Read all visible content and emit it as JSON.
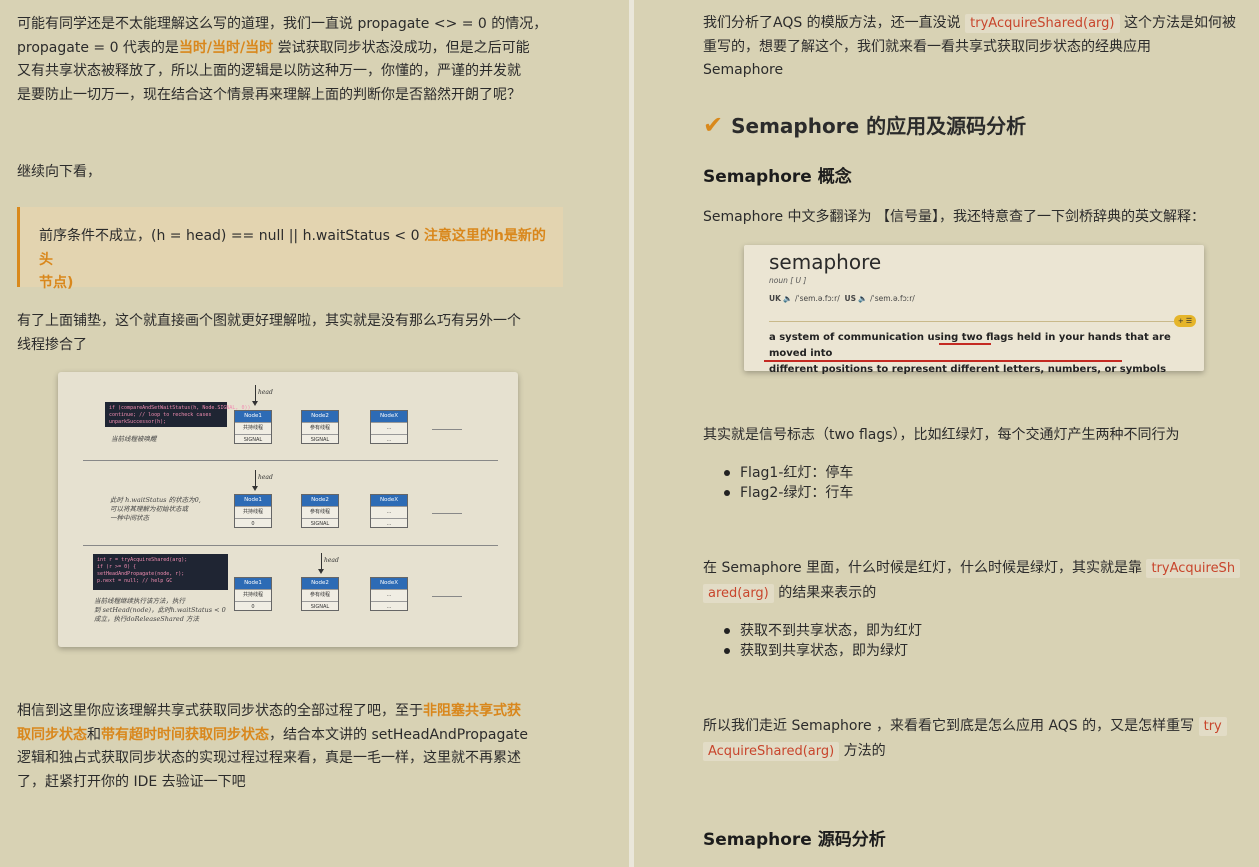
{
  "left": {
    "p1": [
      "可能有同学还是不太能理解这么写的道理，我们一直说 propagate <> = 0 的情况，",
      "propagate = 0 代表的是",
      "当时/当时/当时",
      " 尝试获取同步状态没成功，但是之后可能",
      "又有共享状态被释放了，所以上面的逻辑是以防这种万一，你懂的，严谨的并发就",
      "是要防止一切万一，现在结合这个情景再来理解上面的判断你是否豁然开朗了呢？"
    ],
    "p2": "继续向下看，",
    "quote": [
      "前序条件不成立，(h = head) == null || h.waitStatus < 0 ",
      "注意这里的h是新的头",
      "节点)"
    ],
    "p3": [
      "有了上面铺垫，这个就直接画个图就更好理解啦，其实就是没有那么巧有另外一个",
      "线程掺合了"
    ],
    "figure": {
      "head": "head",
      "node1": "Node1",
      "node2": "Node2",
      "node3": "NodeX",
      "row1_note": "当前线程被唤醒",
      "row2_note": [
        "此时 h.waitStatus 的状态为0,",
        "可以将其理解为初始状态或",
        "一种中间状态"
      ],
      "row3_note": [
        "当前线程继续执行该方法，执行",
        "到 setHead(node)，此时h.waitStatus < 0",
        "成立，执行doReleaseShared 方法"
      ],
      "cell_thread": "共持线程",
      "cell_thread2": "参有线程",
      "cell_signal": "SIGNAL",
      "cell_zero": "0",
      "cell_dots": "…",
      "code1": [
        "if (compareAndSetWaitStatus(h, Node.SIGNAL, 0))",
        "    continue;      // loop to recheck cases",
        "unparkSuccessor(h);"
      ],
      "code3": [
        "int r = tryAcquireShared(arg);",
        "if (r >= 0) {",
        "    setHeadAndPropagate(node, r);",
        "    p.next = null; // help GC"
      ]
    },
    "p4": [
      "相信到这里你应该理解共享式获取同步状态的全部过程了吧，至于",
      "非阻塞共享式获",
      "取同步状态",
      "和",
      "带有超时时间获取同步状态",
      "，结合本文讲的 setHeadAndPropagate",
      "逻辑和独占式获取同步状态的实现过程过程来看，真是一毛一样，这里就不再累述",
      "了，赶紧打开你的 IDE 去验证一下吧"
    ]
  },
  "right": {
    "p1": [
      "我们分析了AQS 的模版方法，还一直没说 ",
      "tryAcquireShared(arg)",
      " 这个方法是如何被",
      "重写的，想要了解这个，我们就来看一看共享式获取同步状态的经典应用",
      "Semaphore"
    ],
    "section_title": "Semaphore 的应用及源码分析",
    "sub1": "Semaphore 概念",
    "p2": "Semaphore 中文多翻译为 【信号量】，我还特意查了一下剑桥辞典的英文解释：",
    "dict": {
      "word": "semaphore",
      "pos": "noun [ U ]",
      "uk": "UK",
      "uk_pron": "/ˈsem.ə.fɔːr/",
      "us": "US",
      "us_pron": "/ˈsem.ə.fɔːr/",
      "badge": "+ ☰",
      "def1a": "a system of communication using ",
      "def1b": "two flags",
      "def1c": " held in your hands that are moved into",
      "def2": "different positions to represent different letters, numbers, or symbols"
    },
    "p3": "其实就是信号标志（two flags），比如红绿灯，每个交通灯产生两种不同行为",
    "list1": [
      "Flag1-红灯：停车",
      "Flag2-绿灯：行车"
    ],
    "p4": [
      "在 Semaphore 里面，什么时候是红灯，什么时候是绿灯，其实就是靠 ",
      "tryAcquireSh",
      "ared(arg)",
      " 的结果来表示的"
    ],
    "list2": [
      "获取不到共享状态，即为红灯",
      "获取到共享状态，即为绿灯"
    ],
    "p5": [
      "所以我们走近 Semaphore ，来看看它到底是怎么应用 AQS 的，又是怎样重写 ",
      "try",
      "AcquireShared(arg)",
      " 方法的"
    ],
    "sub2": "Semaphore 源码分析"
  },
  "colors": {
    "accent": "#d9871c",
    "code": "#c8452c",
    "page_bg": "#d8d2b4",
    "node_head": "#2d6bb5",
    "underline": "#c42a22"
  }
}
